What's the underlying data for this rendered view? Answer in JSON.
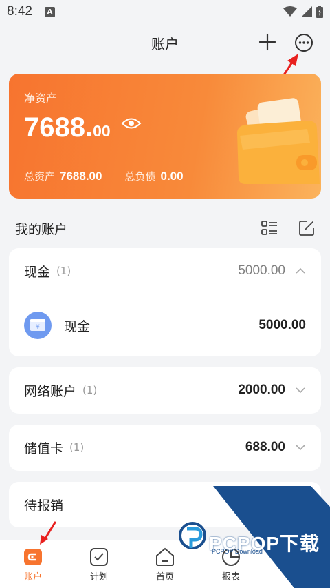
{
  "status": {
    "time": "8:42",
    "notif": "A"
  },
  "header": {
    "title": "账户"
  },
  "net": {
    "label": "净资产",
    "amount_int": "7688.",
    "amount_dec": "00",
    "total_assets_label": "总资产",
    "total_assets": "7688.00",
    "total_debt_label": "总负债",
    "total_debt": "0.00"
  },
  "section": {
    "title": "我的账户"
  },
  "accounts": {
    "cash": {
      "name": "现金",
      "count": "(1)",
      "amount": "5000.00",
      "item": {
        "name": "现金",
        "amount": "5000.00"
      }
    },
    "online": {
      "name": "网络账户",
      "count": "(1)",
      "amount": "2000.00"
    },
    "stored": {
      "name": "储值卡",
      "count": "(1)",
      "amount": "688.00"
    },
    "reimburse": {
      "name": "待报销"
    }
  },
  "tabs": [
    {
      "label": "账户"
    },
    {
      "label": "计划"
    },
    {
      "label": "首页"
    },
    {
      "label": "报表"
    },
    {
      "label": ""
    }
  ],
  "watermark": {
    "text": "PCPOP下载",
    "sub": "PCPOP Download"
  },
  "colors": {
    "accent": "#f7742f",
    "card_blue": "#6f9af0",
    "arrow": "#e8211f"
  }
}
